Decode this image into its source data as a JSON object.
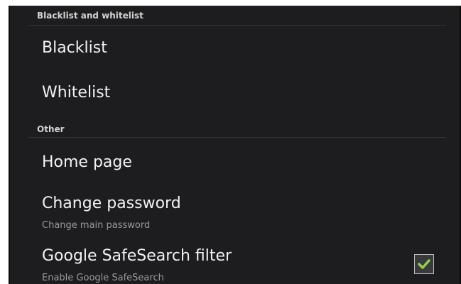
{
  "sections": {
    "blacklist_whitelist": {
      "header": "Blacklist and whitelist",
      "blacklist": {
        "title": "Blacklist"
      },
      "whitelist": {
        "title": "Whitelist"
      }
    },
    "other": {
      "header": "Other",
      "home_page": {
        "title": "Home page"
      },
      "change_password": {
        "title": "Change password",
        "summary": "Change main password"
      },
      "safesearch": {
        "title": "Google SafeSearch filter",
        "summary": "Enable Google SafeSearch",
        "checked": true
      }
    }
  },
  "colors": {
    "background": "#1d1d1f",
    "title_text": "#f2f2f2",
    "summary_text": "#9a9a9a",
    "check_green": "#8fd14f"
  }
}
